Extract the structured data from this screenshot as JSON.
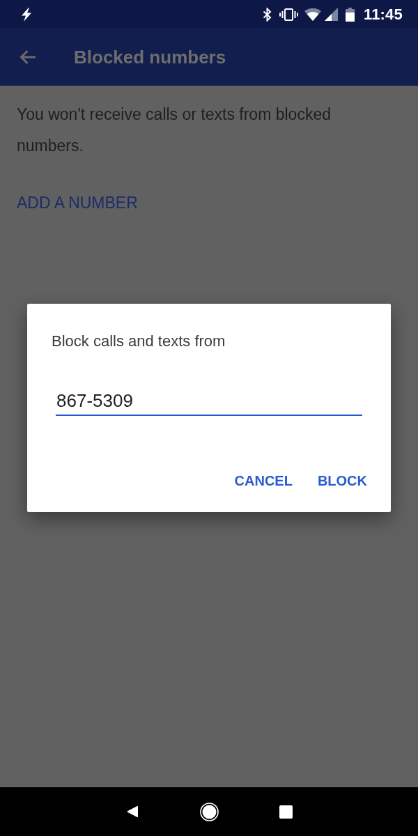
{
  "status_bar": {
    "time": "11:45"
  },
  "app_bar": {
    "title": "Blocked numbers"
  },
  "page": {
    "description": "You won't receive calls or texts from blocked numbers.",
    "add_button": "ADD A NUMBER"
  },
  "dialog": {
    "title": "Block calls and texts from",
    "field": {
      "value": "867-5309",
      "focused": true
    },
    "buttons": [
      "CANCEL",
      "BLOCK"
    ]
  }
}
